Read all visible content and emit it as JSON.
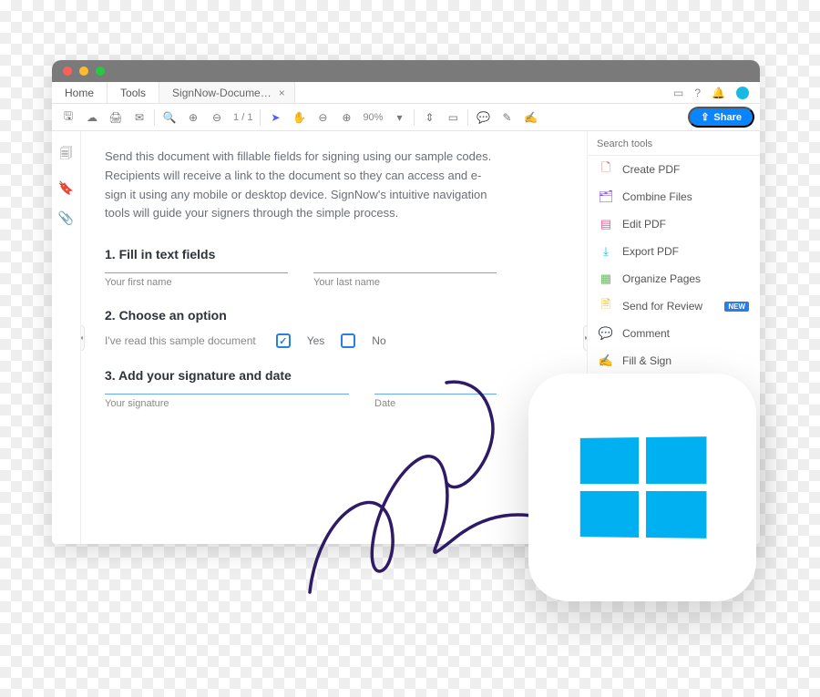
{
  "menubar": {
    "home": "Home",
    "tools": "Tools",
    "doc_tab": "SignNow-Docume…"
  },
  "toolbar": {
    "page_current": "1",
    "page_sep": "/",
    "page_total": "1",
    "zoom": "90%",
    "share": "Share"
  },
  "doc": {
    "intro": "Send this document with fillable fields for signing using our sample codes. Recipients will receive a link to the document so they can access and e-sign it using any mobile or desktop device. SignNow's intuitive navigation tools will guide your signers through the simple process.",
    "step1": "1. Fill in text fields",
    "first_name": "Your first name",
    "last_name": "Your last name",
    "step2": "2. Choose an option",
    "read_prompt": "I've read this sample document",
    "yes": "Yes",
    "no": "No",
    "step3": "3. Add your signature and date",
    "signature": "Your signature",
    "date": "Date"
  },
  "right": {
    "search_placeholder": "Search tools",
    "items": [
      {
        "label": "Create PDF",
        "color": "red"
      },
      {
        "label": "Combine Files",
        "color": "purple"
      },
      {
        "label": "Edit PDF",
        "color": "pink"
      },
      {
        "label": "Export PDF",
        "color": "blue"
      },
      {
        "label": "Organize Pages",
        "color": "green"
      },
      {
        "label": "Send for Review",
        "color": "yellow",
        "new": "NEW"
      },
      {
        "label": "Comment",
        "color": "orange"
      },
      {
        "label": "Fill & Sign",
        "color": "violet"
      }
    ]
  }
}
